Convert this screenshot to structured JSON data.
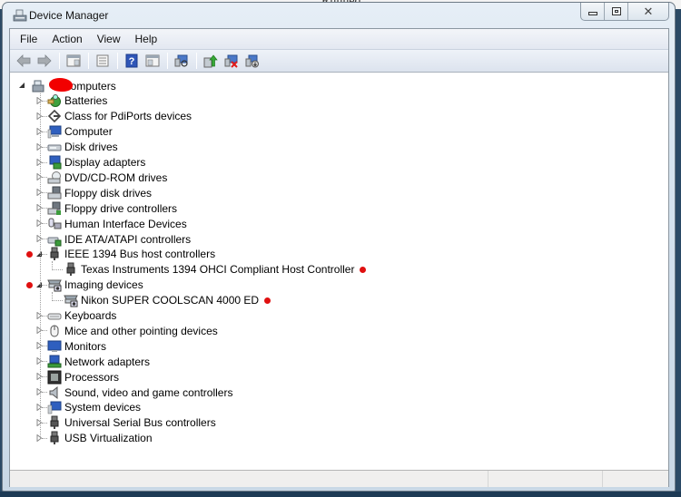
{
  "background_text": "Runned",
  "window": {
    "title": "Device Manager",
    "caption_buttons": {
      "minimize": "▭",
      "maximize": "▣",
      "close": "✕"
    }
  },
  "menu": [
    "File",
    "Action",
    "View",
    "Help"
  ],
  "toolbar": [
    {
      "name": "back",
      "icon": "back-arrow-icon"
    },
    {
      "name": "forward",
      "icon": "forward-arrow-icon"
    },
    {
      "sep": true
    },
    {
      "name": "show-hide-console-tree",
      "icon": "console-tree-icon"
    },
    {
      "sep": true
    },
    {
      "name": "properties",
      "icon": "properties-icon"
    },
    {
      "sep": true
    },
    {
      "name": "help",
      "icon": "help-icon"
    },
    {
      "name": "show-hide-action-pane",
      "icon": "action-pane-icon"
    },
    {
      "sep": true
    },
    {
      "name": "scan-hardware-changes",
      "icon": "scan-hardware-icon"
    },
    {
      "sep": true
    },
    {
      "name": "update-driver",
      "icon": "update-driver-icon"
    },
    {
      "name": "uninstall",
      "icon": "uninstall-icon"
    },
    {
      "name": "disable",
      "icon": "disable-device-icon"
    }
  ],
  "tree": {
    "root": {
      "label": "Computers",
      "redacted_prefix": true,
      "icon": "computer-root-icon",
      "expanded": true
    },
    "categories": [
      {
        "label": "Batteries",
        "icon": "battery-icon",
        "expanded": false
      },
      {
        "label": "Class for PdiPorts devices",
        "icon": "ports-icon",
        "expanded": false
      },
      {
        "label": "Computer",
        "icon": "computer-icon",
        "expanded": false
      },
      {
        "label": "Disk drives",
        "icon": "disk-drive-icon",
        "expanded": false
      },
      {
        "label": "Display adapters",
        "icon": "display-adapter-icon",
        "expanded": false
      },
      {
        "label": "DVD/CD-ROM drives",
        "icon": "dvd-icon",
        "expanded": false
      },
      {
        "label": "Floppy disk drives",
        "icon": "floppy-icon",
        "expanded": false
      },
      {
        "label": "Floppy drive controllers",
        "icon": "floppy-controller-icon",
        "expanded": false
      },
      {
        "label": "Human Interface Devices",
        "icon": "hid-icon",
        "expanded": false
      },
      {
        "label": "IDE ATA/ATAPI controllers",
        "icon": "ide-controller-icon",
        "expanded": false
      },
      {
        "label": "IEEE 1394 Bus host controllers",
        "icon": "ieee1394-icon",
        "expanded": true,
        "marked": true,
        "children": [
          {
            "label": "Texas Instruments 1394 OHCI Compliant Host Controller",
            "icon": "ieee1394-icon",
            "marked": true
          }
        ]
      },
      {
        "label": "Imaging devices",
        "icon": "scanner-icon",
        "expanded": true,
        "marked": true,
        "children": [
          {
            "label": "Nikon SUPER COOLSCAN 4000 ED",
            "icon": "scanner-icon",
            "marked": true
          }
        ]
      },
      {
        "label": "Keyboards",
        "icon": "keyboard-icon",
        "expanded": false
      },
      {
        "label": "Mice and other pointing devices",
        "icon": "mouse-icon",
        "expanded": false
      },
      {
        "label": "Monitors",
        "icon": "monitor-icon",
        "expanded": false
      },
      {
        "label": "Network adapters",
        "icon": "network-adapter-icon",
        "expanded": false
      },
      {
        "label": "Processors",
        "icon": "processor-icon",
        "expanded": false
      },
      {
        "label": "Sound, video and game controllers",
        "icon": "speaker-icon",
        "expanded": false
      },
      {
        "label": "System devices",
        "icon": "system-devices-icon",
        "expanded": false
      },
      {
        "label": "Universal Serial Bus controllers",
        "icon": "usb-icon",
        "expanded": false
      },
      {
        "label": "USB Virtualization",
        "icon": "usb-icon",
        "expanded": false
      }
    ]
  },
  "marker_color": "#e01010",
  "statusbar": [
    "",
    "",
    ""
  ]
}
